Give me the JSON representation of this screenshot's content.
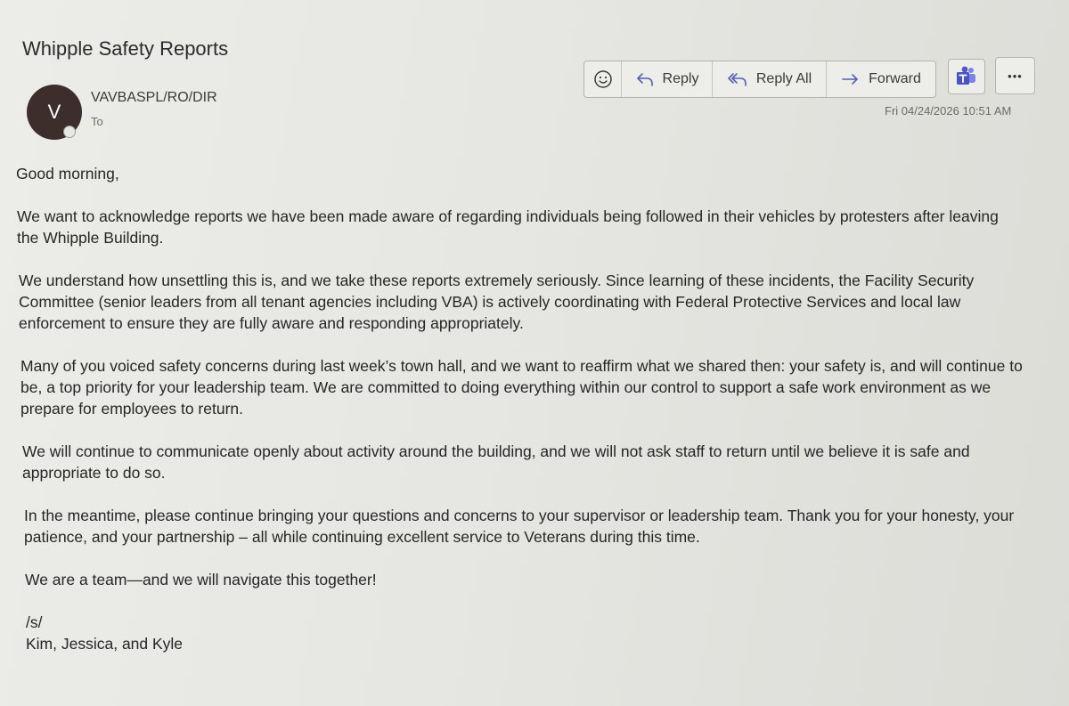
{
  "email": {
    "subject": "Whipple Safety Reports",
    "sender_initial": "V",
    "sender": "VAVBASPL/RO/DIR",
    "to_label": "To",
    "timestamp": "Fri 04/24/2026 10:51 AM"
  },
  "toolbar": {
    "reply_label": "Reply",
    "reply_all_label": "Reply All",
    "forward_label": "Forward",
    "more_label": "•••"
  },
  "icons": {
    "emoji": "smiley-icon",
    "reply": "reply-arrow-icon",
    "reply_all": "reply-all-arrow-icon",
    "forward": "forward-arrow-icon",
    "teams": "teams-icon",
    "more": "more-dots-icon"
  },
  "colors": {
    "avatar_bg": "#3d2d2b",
    "teams_purple": "#4b53bc"
  },
  "body": {
    "greeting": "Good morning,",
    "paragraphs": [
      "We want to acknowledge reports we have been made aware of regarding individuals being followed in their vehicles by protesters after leaving the Whipple Building.",
      "We understand how unsettling this is, and we take these reports extremely seriously. Since learning of these incidents, the Facility Security Committee (senior leaders from all tenant agencies including VBA) is actively coordinating with Federal Protective Services and local law enforcement to ensure they are fully aware and responding appropriately.",
      "Many of you voiced safety concerns during last week’s town hall, and we want to reaffirm what we shared then: your safety is, and will continue to be, a top priority for your leadership team. We are committed to doing everything within our control to support a safe work environment as we prepare for employees to return.",
      "We will continue to communicate openly about activity around the building, and we will not ask staff to return until we believe it is safe and appropriate to do so.",
      "In the meantime, please continue bringing your questions and concerns to your supervisor or leadership team. Thank you for your honesty, your patience, and your partnership – all while continuing excellent service to Veterans during this time.",
      "We are a team—and we will navigate this together!"
    ],
    "signature_mark": "/s/",
    "signature_names": "Kim, Jessica, and Kyle"
  }
}
